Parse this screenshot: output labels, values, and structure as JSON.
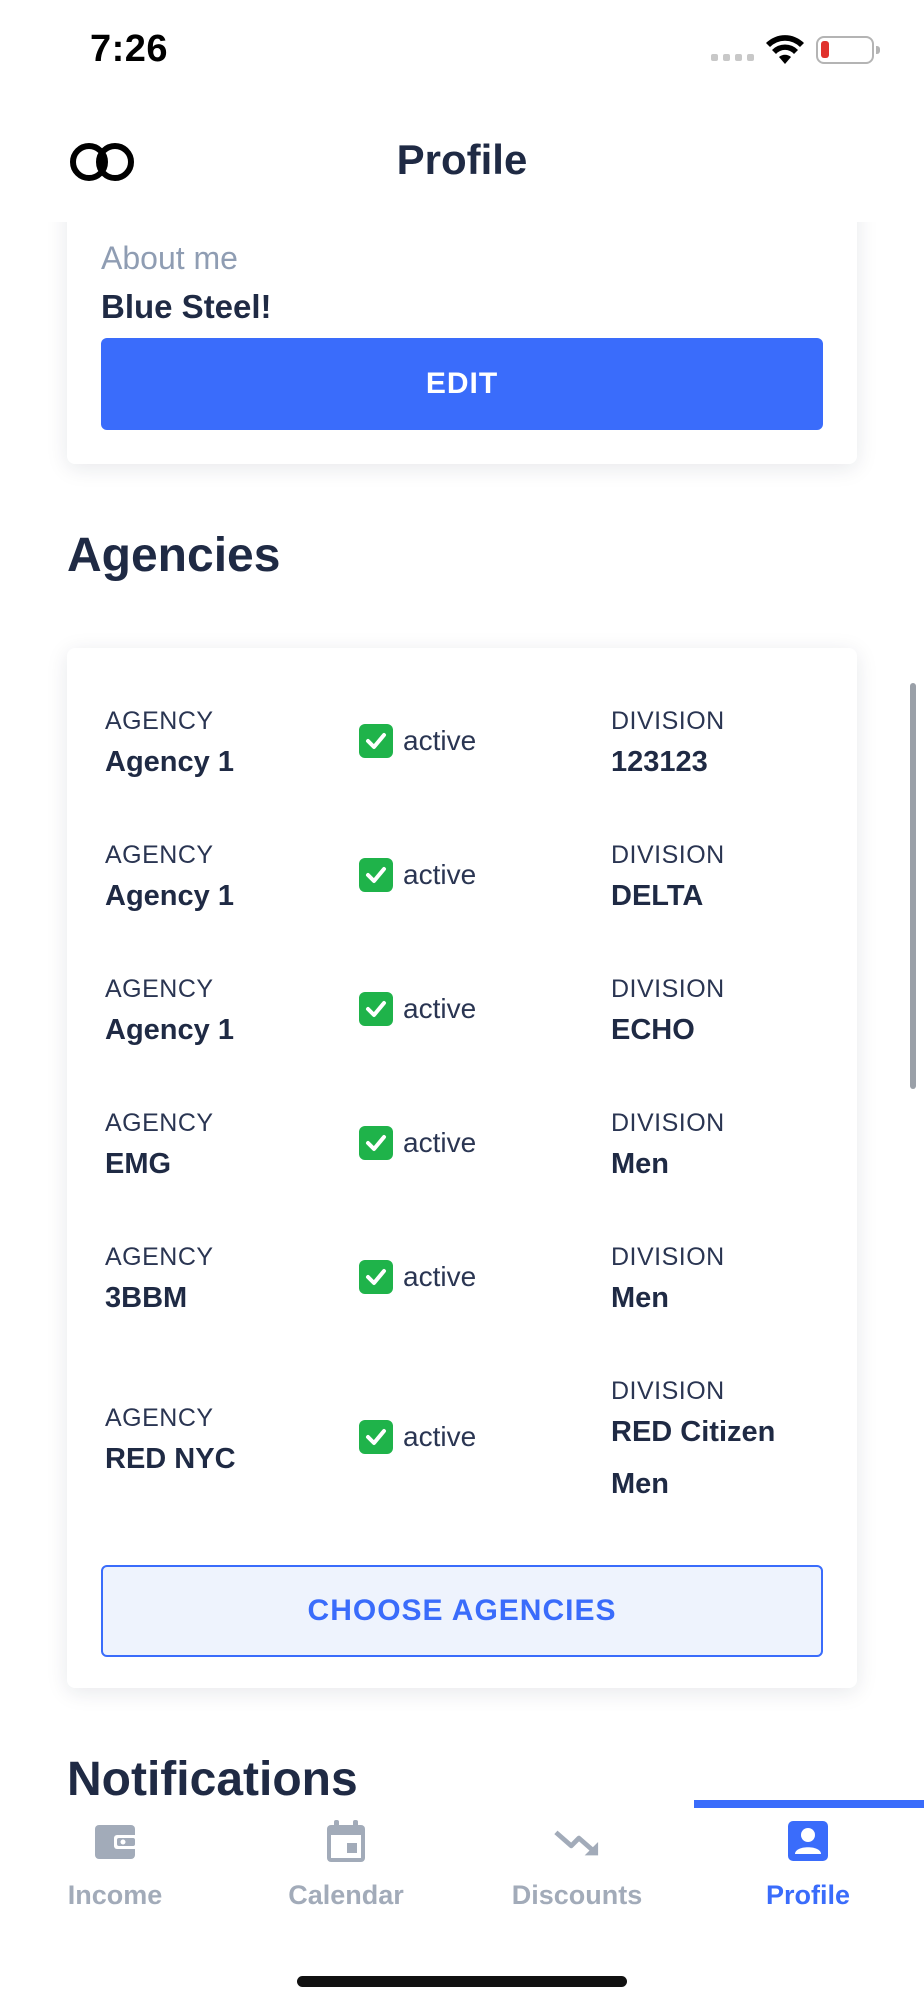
{
  "status_bar": {
    "time": "7:26",
    "battery_color": "#e0322d"
  },
  "header": {
    "title": "Profile",
    "logo_icon": "linked-rings-logo"
  },
  "about": {
    "label": "About me",
    "value": "Blue Steel!",
    "edit_label": "EDIT"
  },
  "agencies": {
    "title": "Agencies",
    "rows": [
      {
        "agency_label": "AGENCY",
        "agency": "Agency 1",
        "status": "active",
        "division_label": "DIVISION",
        "division": "123123"
      },
      {
        "agency_label": "AGENCY",
        "agency": "Agency 1",
        "status": "active",
        "division_label": "DIVISION",
        "division": "DELTA"
      },
      {
        "agency_label": "AGENCY",
        "agency": "Agency 1",
        "status": "active",
        "division_label": "DIVISION",
        "division": "ECHO"
      },
      {
        "agency_label": "AGENCY",
        "agency": "EMG",
        "status": "active",
        "division_label": "DIVISION",
        "division": "Men"
      },
      {
        "agency_label": "AGENCY",
        "agency": "3BBM",
        "status": "active",
        "division_label": "DIVISION",
        "division": "Men"
      },
      {
        "agency_label": "AGENCY",
        "agency": "RED NYC",
        "status": "active",
        "division_label": "DIVISION",
        "division": "RED Citizen",
        "division_line2": "Men"
      }
    ],
    "choose_label": "CHOOSE AGENCIES"
  },
  "notifications": {
    "title": "Notifications"
  },
  "tabs": [
    {
      "label": "Income",
      "icon": "wallet-icon",
      "active": false
    },
    {
      "label": "Calendar",
      "icon": "calendar-icon",
      "active": false
    },
    {
      "label": "Discounts",
      "icon": "trending-down-icon",
      "active": false
    },
    {
      "label": "Profile",
      "icon": "person-badge-icon",
      "active": true
    }
  ],
  "colors": {
    "accent": "#3a6cfb",
    "text_dark": "#1f2a44",
    "text_muted": "#8f9db3",
    "tab_inactive": "#a2abb9",
    "status_active": "#1fb34a"
  }
}
